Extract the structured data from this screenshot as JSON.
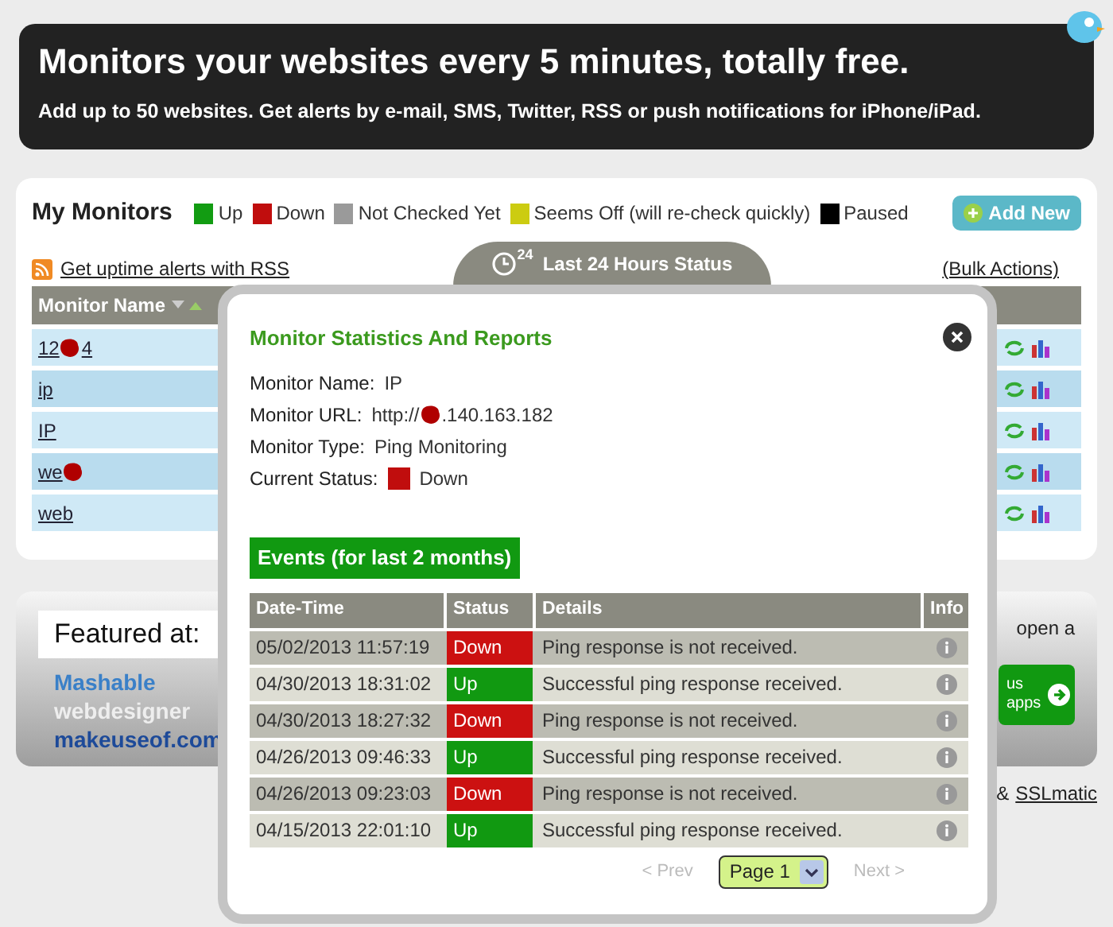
{
  "banner": {
    "headline": "Monitors your websites every 5 minutes, totally free.",
    "subline": "Add up to 50 websites. Get alerts by e-mail, SMS, Twitter, RSS or push notifications for iPhone/iPad."
  },
  "monitors": {
    "title": "My Monitors",
    "legend": [
      {
        "label": "Up",
        "color": "#129c12"
      },
      {
        "label": "Down",
        "color": "#c00d0d"
      },
      {
        "label": "Not Checked Yet",
        "color": "#9a9a9a"
      },
      {
        "label": "Seems Off (will re-check quickly)",
        "color": "#cccc11"
      },
      {
        "label": "Paused",
        "color": "#000000"
      }
    ],
    "add_button": "Add New",
    "rss_link": "Get uptime alerts with RSS",
    "status_tab": "Last 24 Hours Status",
    "status_tab_badge": "24",
    "bulk_link": "(Bulk Actions)",
    "column_1": "Monitor Name",
    "rows": [
      {
        "name": "12",
        "redacted": true,
        "name_end": "4"
      },
      {
        "name": "ip",
        "redacted": false,
        "name_end": ""
      },
      {
        "name": "IP",
        "redacted": false,
        "name_end": ""
      },
      {
        "name": "we",
        "redacted": true,
        "name_end": ""
      },
      {
        "name": "web",
        "redacted": false,
        "name_end": ""
      }
    ]
  },
  "featured": {
    "title": "Featured at:",
    "logos": [
      "Mashable",
      "webdesigner",
      "makeuseof.com"
    ],
    "side_text": "open a",
    "button_lines": [
      "us",
      "apps"
    ],
    "footer_sep": "&",
    "footer_link": "SSLmatic"
  },
  "popup": {
    "title": "Monitor Statistics And Reports",
    "fields": [
      {
        "kind": "text",
        "label": "Monitor Name:",
        "value": "IP"
      },
      {
        "kind": "url",
        "label": "Monitor URL:",
        "value": "http://",
        "value_end": ".140.163.182"
      },
      {
        "kind": "text",
        "label": "Monitor Type:",
        "value": "Ping Monitoring"
      },
      {
        "kind": "status",
        "label": "Current Status:",
        "value": "Down",
        "color": "#c00d0d"
      }
    ],
    "events_title": "Events (for last 2 months)",
    "columns": [
      "Date-Time",
      "Status",
      "Details",
      "Info"
    ],
    "events": [
      {
        "time": "05/02/2013 11:57:19",
        "status": "Down",
        "kind": "down",
        "details": "Ping response is not received."
      },
      {
        "time": "04/30/2013 18:31:02",
        "status": "Up",
        "kind": "up",
        "details": "Successful ping response received."
      },
      {
        "time": "04/30/2013 18:27:32",
        "status": "Down",
        "kind": "down",
        "details": "Ping response is not received."
      },
      {
        "time": "04/26/2013 09:46:33",
        "status": "Up",
        "kind": "up",
        "details": "Successful ping response received."
      },
      {
        "time": "04/26/2013 09:23:03",
        "status": "Down",
        "kind": "down",
        "details": "Ping response is not received."
      },
      {
        "time": "04/15/2013 22:01:10",
        "status": "Up",
        "kind": "up",
        "details": "Successful ping response received."
      }
    ],
    "prev": {
      "label": "< Prev",
      "disabled": true
    },
    "page": "Page 1",
    "next": {
      "label": "Next >",
      "disabled": true
    }
  }
}
